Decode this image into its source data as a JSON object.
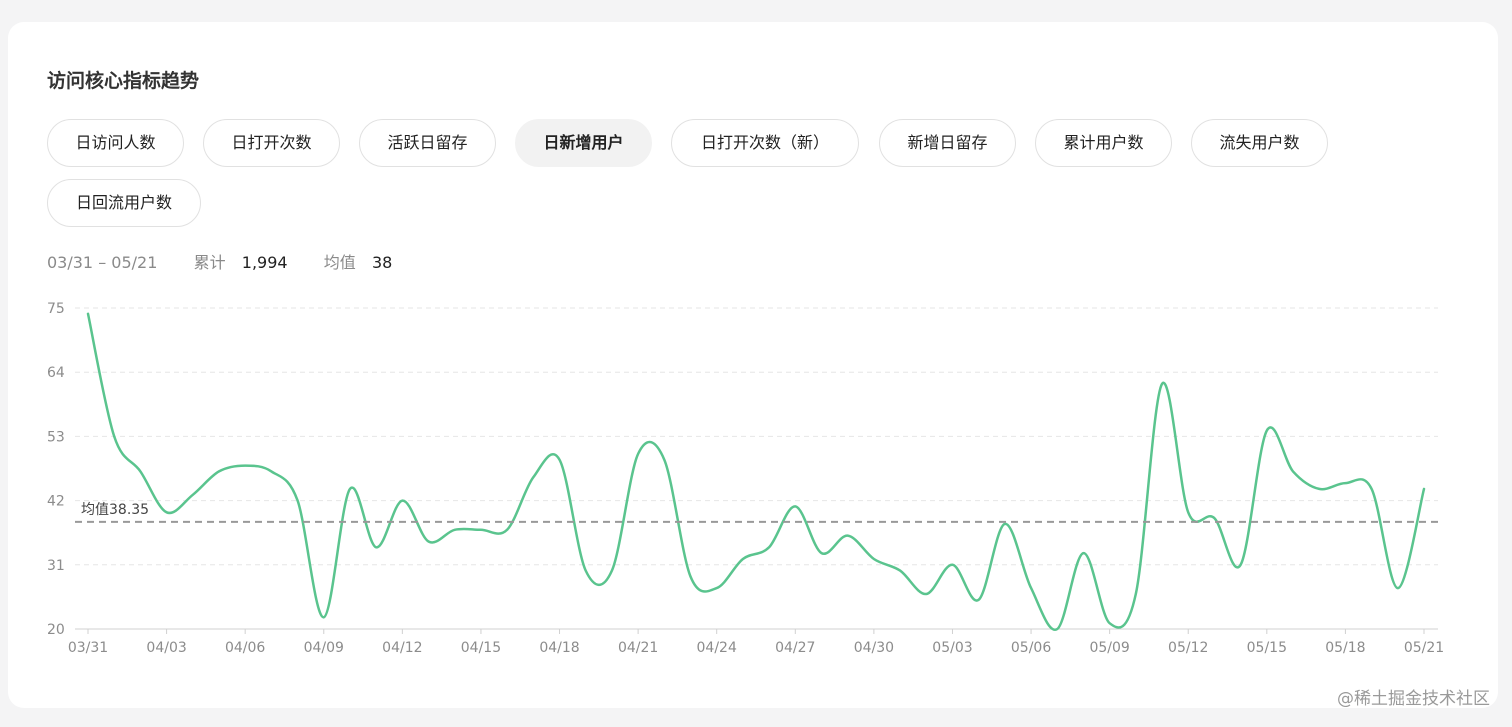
{
  "title": "访问核心指标趋势",
  "tabs": [
    {
      "label": "日访问人数",
      "active": false
    },
    {
      "label": "日打开次数",
      "active": false
    },
    {
      "label": "活跃日留存",
      "active": false
    },
    {
      "label": "日新增用户",
      "active": true
    },
    {
      "label": "日打开次数（新）",
      "active": false
    },
    {
      "label": "新增日留存",
      "active": false
    },
    {
      "label": "累计用户数",
      "active": false
    },
    {
      "label": "流失用户数",
      "active": false
    },
    {
      "label": "日回流用户数",
      "active": false
    }
  ],
  "summary": {
    "range": "03/31 – 05/21",
    "total_label": "累计",
    "total_value": "1,994",
    "avg_label": "均值",
    "avg_value": "38"
  },
  "chart_data": {
    "type": "line",
    "title": "",
    "xlabel": "",
    "ylabel": "",
    "ylim": [
      20,
      75
    ],
    "yticks": [
      20,
      31,
      42,
      53,
      64,
      75
    ],
    "xticks": [
      "03/31",
      "04/03",
      "04/06",
      "04/09",
      "04/12",
      "04/15",
      "04/18",
      "04/21",
      "04/24",
      "04/27",
      "04/30",
      "05/03",
      "05/06",
      "05/09",
      "05/12",
      "05/15",
      "05/18",
      "05/21"
    ],
    "grid": true,
    "color": "#5ac48e",
    "average_line": {
      "label": "均值38.35",
      "value": 38.35,
      "color": "#999999"
    },
    "series": [
      {
        "x": [
          "03/31",
          "04/01",
          "04/02",
          "04/03",
          "04/04",
          "04/05",
          "04/06",
          "04/07",
          "04/08",
          "04/09",
          "04/10",
          "04/11",
          "04/12",
          "04/13",
          "04/14",
          "04/15",
          "04/16",
          "04/17",
          "04/18",
          "04/19",
          "04/20",
          "04/21",
          "04/22",
          "04/23",
          "04/24",
          "04/25",
          "04/26",
          "04/27",
          "04/28",
          "04/29",
          "04/30",
          "05/01",
          "05/02",
          "05/03",
          "05/04",
          "05/05",
          "05/06",
          "05/07",
          "05/08",
          "05/09",
          "05/10",
          "05/11",
          "05/12",
          "05/13",
          "05/14",
          "05/15",
          "05/16",
          "05/17",
          "05/18",
          "05/19",
          "05/20",
          "05/21"
        ],
        "values": [
          74,
          53,
          47,
          40,
          43,
          47,
          48,
          47,
          42,
          22,
          44,
          34,
          42,
          35,
          37,
          37,
          37,
          46,
          49,
          30,
          30,
          50,
          49,
          29,
          27,
          32,
          34,
          41,
          33,
          36,
          32,
          30,
          26,
          31,
          25,
          38,
          27,
          20,
          33,
          21,
          26,
          62,
          40,
          39,
          31,
          54,
          47,
          44,
          45,
          44,
          27,
          44
        ]
      }
    ]
  },
  "watermark": "@稀土掘金技术社区"
}
